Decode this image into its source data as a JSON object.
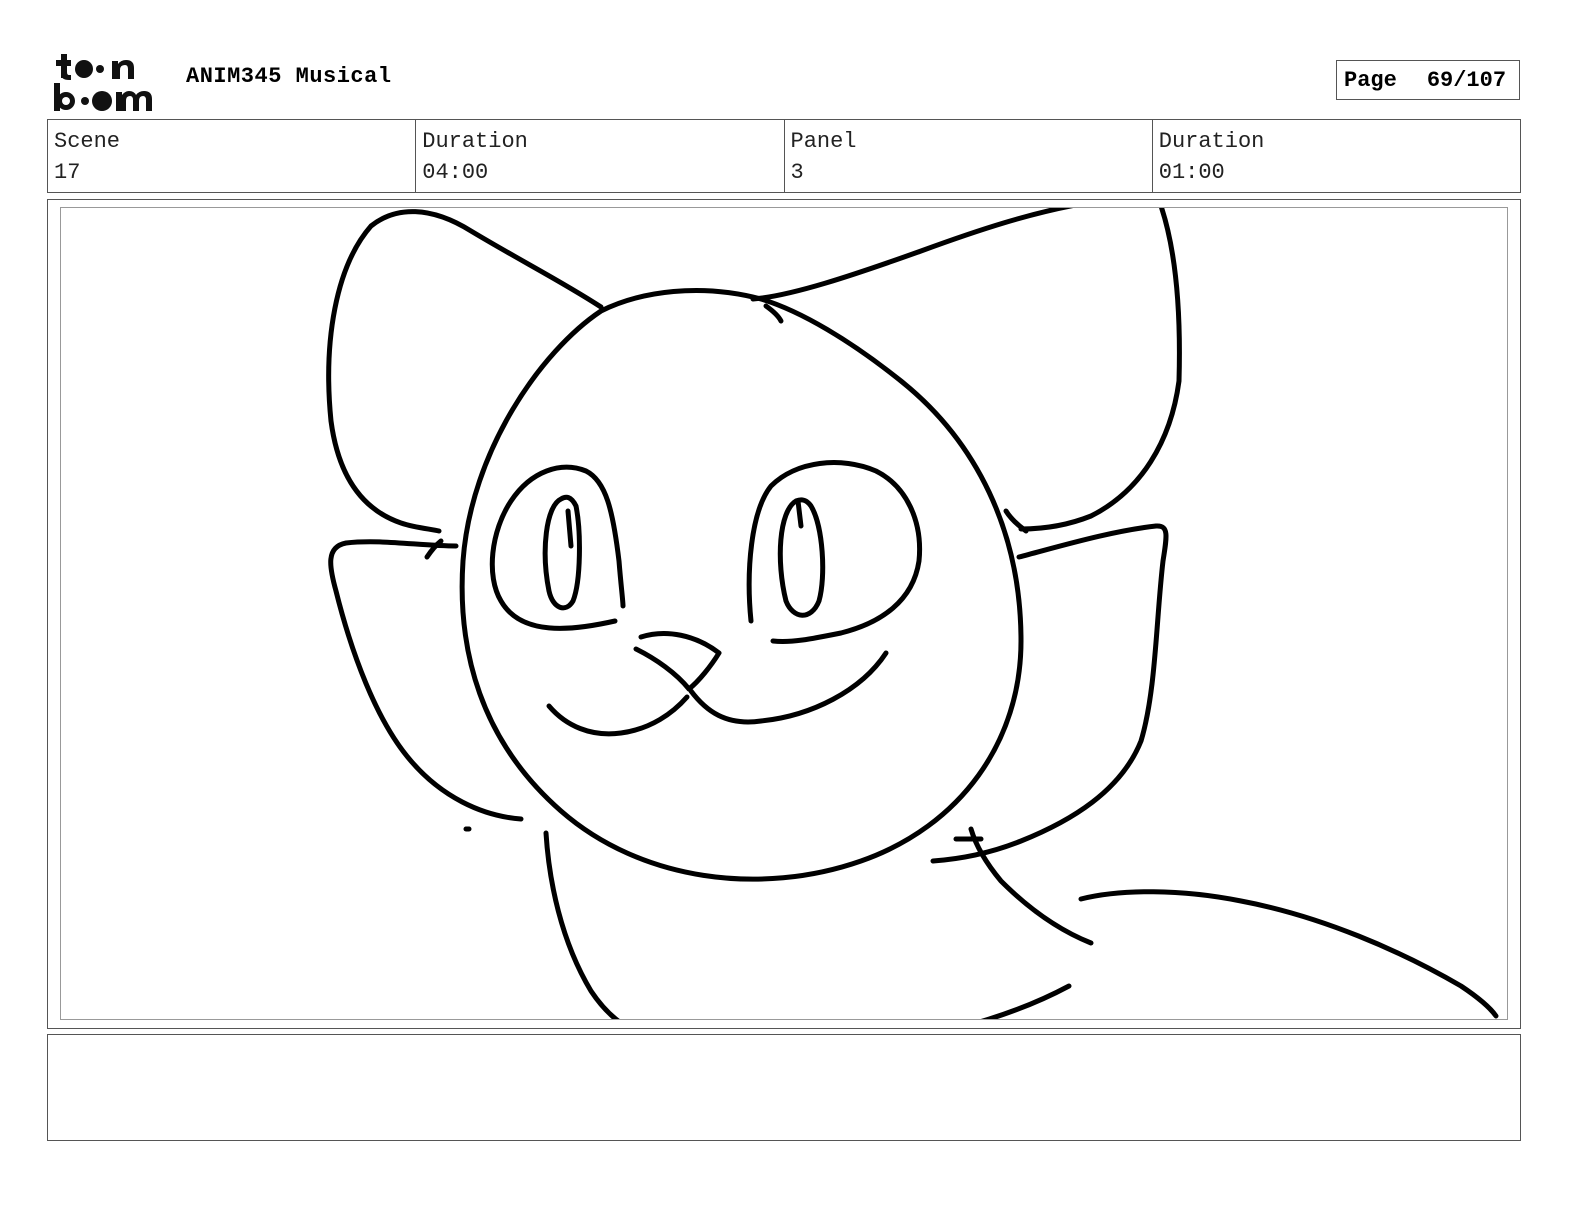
{
  "header": {
    "logo_icon": "toonboom-logo-icon",
    "project_title": "ANIM345 Musical",
    "page_label": "Page",
    "page_number": "69/107"
  },
  "info": {
    "scene_label": "Scene",
    "scene_value": "17",
    "scene_duration_label": "Duration",
    "scene_duration_value": "04:00",
    "panel_label": "Panel",
    "panel_value": "3",
    "panel_duration_label": "Duration",
    "panel_duration_value": "01:00"
  },
  "panel": {
    "drawing_icon": "cat-sketch-drawing"
  },
  "notes": {
    "text": ""
  }
}
